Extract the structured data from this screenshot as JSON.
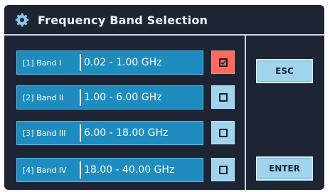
{
  "dialog": {
    "title": "Frequency Band Selection",
    "title_icon": "gear-icon"
  },
  "bands": [
    {
      "label": "[1] Band I",
      "range": "0.02 - 1.00 GHz",
      "checked": true
    },
    {
      "label": "[2] Band II",
      "range": "1.00 - 6.00 GHz",
      "checked": false
    },
    {
      "label": "[3] Band III",
      "range": "6.00 - 18.00 GHz",
      "checked": false
    },
    {
      "label": "[4] Band IV",
      "range": "18.00 - 40.00 GHz",
      "checked": false
    }
  ],
  "actions": {
    "esc_label": "ESC",
    "enter_label": "ENTER"
  },
  "colors": {
    "background": "#1d2535",
    "band_fill": "#1f8cc0",
    "checkbox_button": "#9fd3ee",
    "checkbox_checked": "#ff6a5c",
    "action_button": "#9fd3ee"
  }
}
